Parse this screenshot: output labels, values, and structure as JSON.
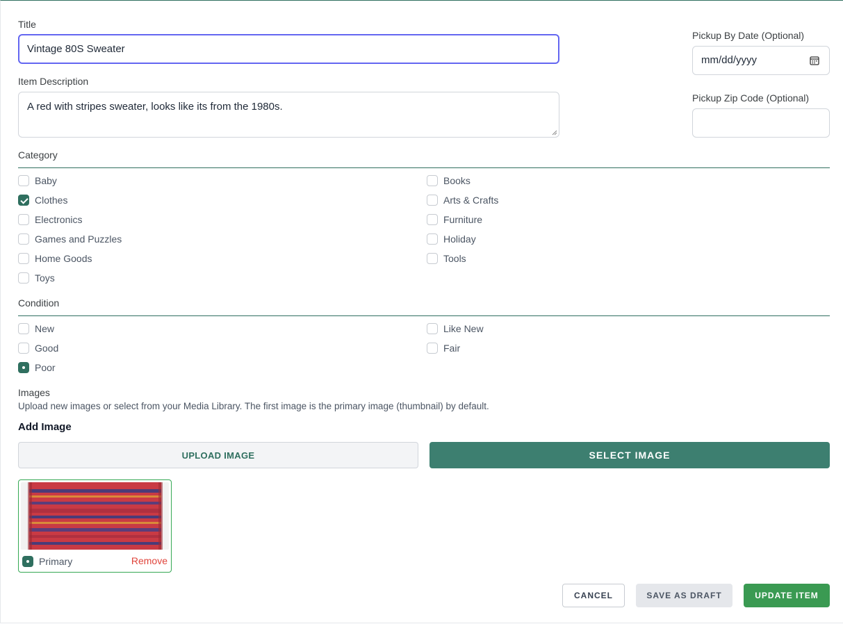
{
  "form": {
    "title_label": "Title",
    "title_value": "Vintage 80S Sweater",
    "description_label": "Item Description",
    "description_value": "A red with stripes sweater, looks like its from the 1980s.",
    "pickup_date_label": "Pickup By Date (Optional)",
    "pickup_date_placeholder": "mm/dd/yyyy",
    "pickup_zip_label": "Pickup Zip Code (Optional)",
    "pickup_zip_value": ""
  },
  "category": {
    "label": "Category",
    "options": [
      {
        "label": "Baby",
        "checked": false
      },
      {
        "label": "Books",
        "checked": false
      },
      {
        "label": "Clothes",
        "checked": true
      },
      {
        "label": "Arts & Crafts",
        "checked": false
      },
      {
        "label": "Electronics",
        "checked": false
      },
      {
        "label": "Furniture",
        "checked": false
      },
      {
        "label": "Games and Puzzles",
        "checked": false
      },
      {
        "label": "Holiday",
        "checked": false
      },
      {
        "label": "Home Goods",
        "checked": false
      },
      {
        "label": "Tools",
        "checked": false
      },
      {
        "label": "Toys",
        "checked": false
      }
    ]
  },
  "condition": {
    "label": "Condition",
    "options": [
      {
        "label": "New",
        "selected": false
      },
      {
        "label": "Like New",
        "selected": false
      },
      {
        "label": "Good",
        "selected": false
      },
      {
        "label": "Fair",
        "selected": false
      },
      {
        "label": "Poor",
        "selected": true
      }
    ]
  },
  "images": {
    "label": "Images",
    "help_text": "Upload new images or select from your Media Library. The first image is the primary image (thumbnail) by default.",
    "add_label": "Add Image",
    "upload_button": "UPLOAD IMAGE",
    "select_button": "SELECT IMAGE",
    "items": [
      {
        "primary_label": "Primary",
        "primary": true,
        "remove_label": "Remove"
      }
    ]
  },
  "actions": {
    "cancel": "CANCEL",
    "save_draft": "SAVE AS DRAFT",
    "update": "UPDATE ITEM"
  },
  "colors": {
    "accent": "#2f6f5f",
    "select_button": "#3d7f70",
    "update_button": "#3a9a52",
    "focus_ring": "#6366f1",
    "remove_link": "#e0443b"
  }
}
